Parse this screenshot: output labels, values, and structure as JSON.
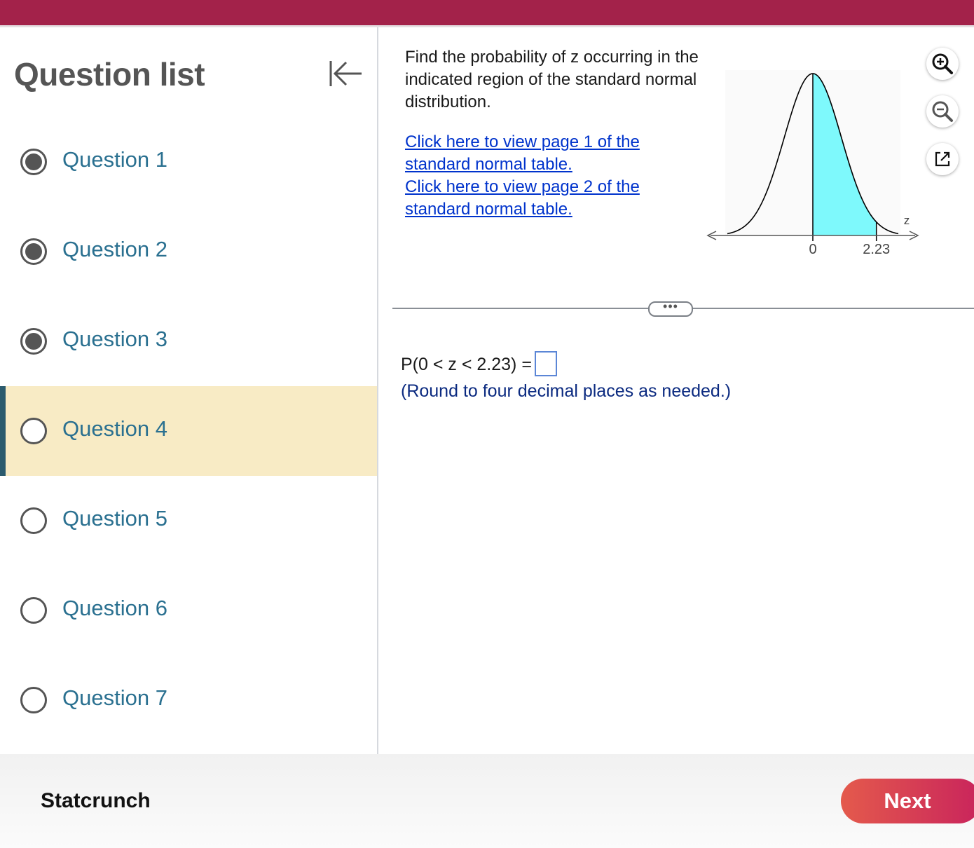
{
  "sidebar": {
    "title": "Question list",
    "questions": [
      {
        "label": "Question 1",
        "state": "answered"
      },
      {
        "label": "Question 2",
        "state": "answered"
      },
      {
        "label": "Question 3",
        "state": "answered"
      },
      {
        "label": "Question 4",
        "state": "current"
      },
      {
        "label": "Question 5",
        "state": "unanswered"
      },
      {
        "label": "Question 6",
        "state": "unanswered"
      },
      {
        "label": "Question 7",
        "state": "unanswered"
      }
    ]
  },
  "question": {
    "prompt": "Find the probability of z occurring in the indicated region of the standard normal distribution.",
    "link1": "Click here to view page 1 of the standard normal table.",
    "link2": "Click here to view page 2 of the standard normal table.",
    "more_label": "•••",
    "equation": "P(0 < z < 2.23) =",
    "answer_value": "",
    "hint": "(Round to four decimal places as needed.)"
  },
  "chart_data": {
    "type": "area",
    "distribution": "standard normal",
    "shaded_from": 0,
    "shaded_to": 2.23,
    "tick_labels": [
      "0",
      "2.23"
    ],
    "axis_label": "z",
    "xlim": [
      -3,
      3
    ],
    "fill_color": "#7ef9fc",
    "curve_color": "#000000"
  },
  "toolbar": {
    "zoom_in": "zoom-in-icon",
    "zoom_out": "zoom-out-icon",
    "popout": "popout-icon"
  },
  "footer": {
    "statcrunch_label": "Statcrunch",
    "next_label": "Next"
  },
  "colors": {
    "brand": "#a3224a",
    "current_row": "#f8ebc5",
    "link": "#0033cc",
    "question_label": "#2a7090"
  }
}
